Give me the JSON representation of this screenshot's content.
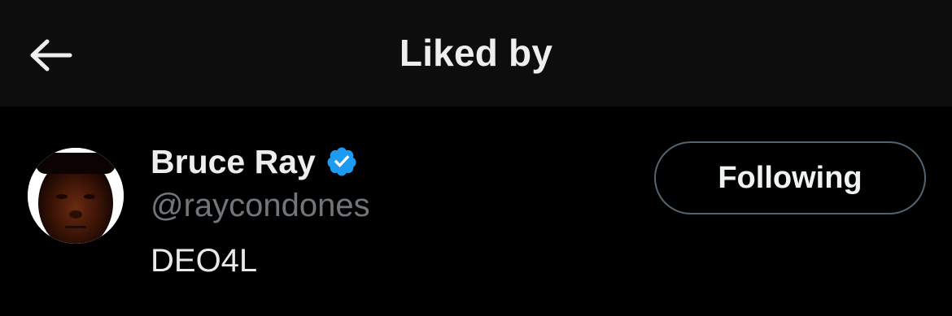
{
  "header": {
    "title": "Liked by",
    "back_icon": "arrow-left-icon"
  },
  "users": [
    {
      "display_name": "Bruce Ray",
      "verified": true,
      "verified_icon": "verified-badge-icon",
      "handle": "@raycondones",
      "bio": "DEO4L",
      "follow_label": "Following"
    }
  ],
  "colors": {
    "background": "#000000",
    "header_background": "#0d0d0d",
    "verified_blue": "#1d9bf0",
    "handle_gray": "#71767b",
    "button_border": "#536471"
  }
}
